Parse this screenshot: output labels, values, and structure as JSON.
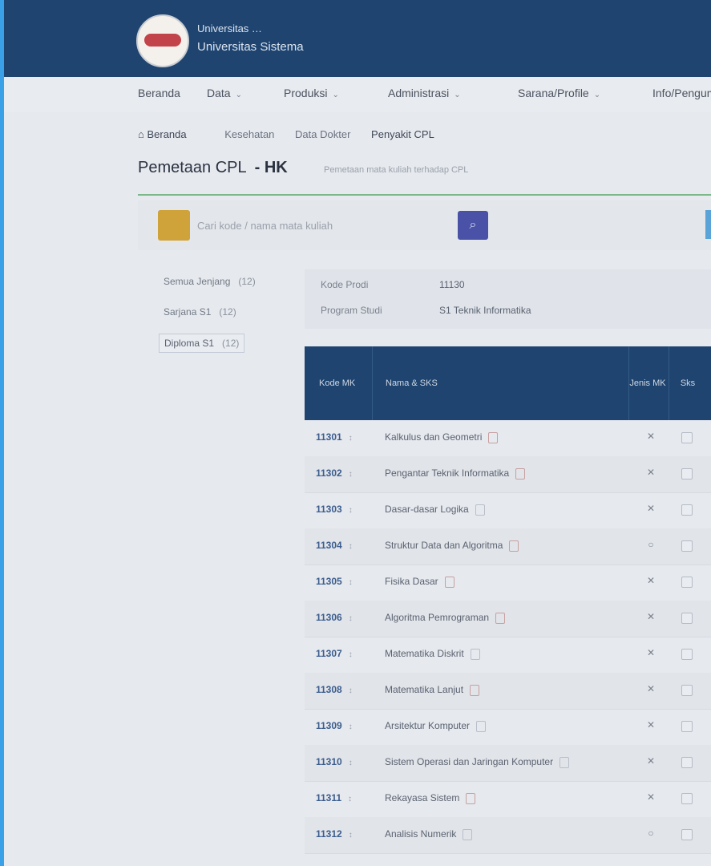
{
  "header": {
    "org_line1": "Universitas …",
    "org_line2": "Universitas Sistema"
  },
  "nav": {
    "items": [
      {
        "label": "Beranda",
        "has_menu": false
      },
      {
        "label": "Data",
        "has_menu": true
      },
      {
        "label": "Produksi",
        "has_menu": true
      },
      {
        "label": "Administrasi",
        "has_menu": true
      },
      {
        "label": "Sarana/Profile",
        "has_menu": true
      },
      {
        "label": "Info/Pengumuman",
        "has_menu": false
      }
    ]
  },
  "breadcrumb": {
    "home": "Beranda",
    "items": [
      "Kesehatan",
      "Data Dokter",
      "Penyakit CPL"
    ]
  },
  "page": {
    "title": "Pemetaan CPL",
    "title_suffix": "- HK",
    "subtitle": "Pemetaan mata kuliah terhadap CPL"
  },
  "search": {
    "placeholder": "Cari kode / nama mata kuliah",
    "go_icon": "search-icon"
  },
  "sidebar": {
    "items": [
      {
        "label": "Semua Jenjang",
        "count": "(12)",
        "active": false
      },
      {
        "label": "Sarjana S1",
        "count": "(12)",
        "active": false
      },
      {
        "label": "Diploma S1",
        "count": "(12)",
        "active": true
      }
    ]
  },
  "info": {
    "rows": [
      {
        "label": "Kode Prodi",
        "value": "11130"
      },
      {
        "label": "Program Studi",
        "value": "S1 Teknik Informatika"
      }
    ]
  },
  "table": {
    "headers": {
      "code": "Kode MK",
      "desc": "Nama & SKS",
      "col3": "Jenis MK",
      "col4": "Sks"
    },
    "rows": [
      {
        "code": "11301",
        "desc": "Kalkulus dan Geometri",
        "x": "✕",
        "flag": "r"
      },
      {
        "code": "11302",
        "desc": "Pengantar Teknik Informatika",
        "x": "✕",
        "flag": "r"
      },
      {
        "code": "11303",
        "desc": "Dasar-dasar Logika",
        "x": "✕",
        "flag": "b"
      },
      {
        "code": "11304",
        "desc": "Struktur Data dan Algoritma",
        "x": "○",
        "flag": "r"
      },
      {
        "code": "11305",
        "desc": "Fisika Dasar",
        "x": "✕",
        "flag": "r"
      },
      {
        "code": "11306",
        "desc": "Algoritma Pemrograman",
        "x": "✕",
        "flag": "r"
      },
      {
        "code": "11307",
        "desc": "Matematika Diskrit",
        "x": "✕",
        "flag": "b"
      },
      {
        "code": "11308",
        "desc": "Matematika Lanjut",
        "x": "✕",
        "flag": "r"
      },
      {
        "code": "11309",
        "desc": "Arsitektur Komputer",
        "x": "✕",
        "flag": "b"
      },
      {
        "code": "11310",
        "desc": "Sistem Operasi dan Jaringan Komputer",
        "x": "✕",
        "flag": "b"
      },
      {
        "code": "11311",
        "desc": "Rekayasa Sistem",
        "x": "✕",
        "flag": "r"
      },
      {
        "code": "11312",
        "desc": "Analisis Numerik",
        "x": "○",
        "flag": "b"
      }
    ]
  }
}
